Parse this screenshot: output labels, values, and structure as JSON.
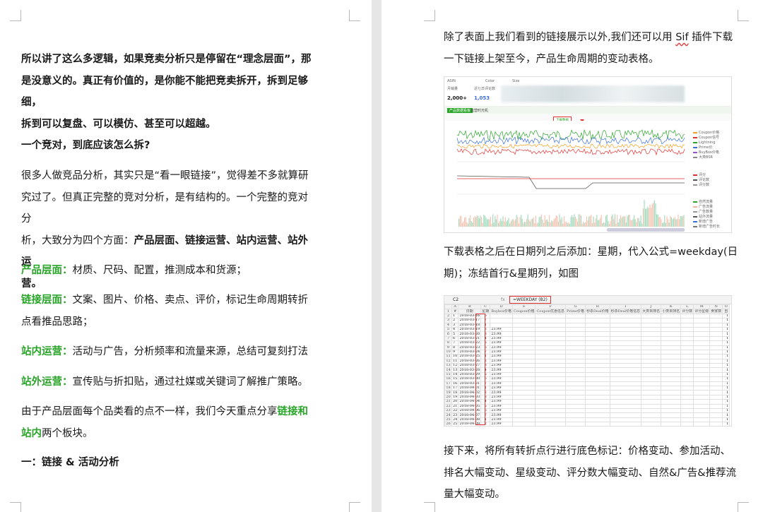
{
  "left_page": {
    "intro": [
      "所以讲了这么多逻辑，如果竞卖分析只是停留在“理念层面”，那",
      "是没意义的。真正有价值的，是你能不能把竞卖拆开，拆到足够细，",
      "拆到可以复盘、可以模仿、甚至可以超越。"
    ],
    "heading": "一个竞对，到底应该怎么拆?",
    "body1": [
      "很多人做竞品分析，其实只是“看一眼链接”，觉得差不多就算研",
      "究过了。但真正完整的竞对分析，是有结构的。一个完整的竞对分",
      "析，大致分为四个方面："
    ],
    "body1_bold_tail": "产品层面、链接运营、站内运营、站外运",
    "body1_last": "营。",
    "items": [
      {
        "label": "产品层面：",
        "text": "材质、尺码、配置，推测成本和货源；"
      },
      {
        "label": "链接层面：",
        "text": "文案、图片、价格、卖点、评价，标记生命周期转折",
        "text2": "点看推品思路；"
      },
      {
        "label": "站内运营：",
        "text": "活动与广告，分析频率和流量来源，总结可复刻打法"
      },
      {
        "label": "站外运营：",
        "text": "宣传贴与折扣贴，通过社媒或关键词了解推广策略。"
      }
    ],
    "closing_1": "由于产品层面每个品类看的点不一样，我们今天重点分享",
    "closing_green": "链接和",
    "closing_green2": "站内",
    "closing_2": "两个板块。",
    "section": "一：链接  &  活动分析"
  },
  "right_page": {
    "p1_a": "除了表面上我们看到的链接展示以外,我们还可以用 ",
    "p1_sif": "Sif",
    "p1_b": " 插件下载",
    "p1_line2": "一下链接上架至今，产品生命周期的变动表格。",
    "p2_line1": "下载表格之后在日期列之后添加：星期，代入公式=weekday(日",
    "p2_line2": "期)；冻结首行&星期列，如图",
    "p3_line1": "接下来，将所有转折点行进行底色标记：价格变动、参加活动、",
    "p3_line2": "排名大幅变动、星级变动、评分数大幅变动、自然&广告&推荐流",
    "p3_line3": "量大幅变动。"
  },
  "shot1": {
    "asin_label": "ASIN",
    "color_label": "Color",
    "size_label": "Size",
    "stat1_label": "月销量",
    "stat1_value": "2,000+",
    "stat2_label": "近七日评论数",
    "stat2_value": "1,053",
    "tab1": "产品数据看板",
    "tab2": "运营时光机",
    "download_btn": "下载数据",
    "legend": [
      "Coupon价格",
      "Coupon信号",
      "Lightning",
      "Prime价",
      "BuyBox价格",
      "大类BSR"
    ],
    "legend2": [
      "评分",
      "评论数",
      "评分数"
    ],
    "legend3": [
      "自然流量",
      "广告流量",
      "广告数量",
      "站外流量",
      "新增广告",
      "新增广告时长"
    ],
    "colors": {
      "green": "#2aa52a",
      "red": "#d33",
      "blue": "#3a6fd8",
      "orange": "#f0a020",
      "purple": "#9a4fd0"
    }
  },
  "shot2": {
    "cell_ref": "C2",
    "formula": "=WEEKDAY (B2)",
    "col_letters": [
      "A",
      "B",
      "C",
      "D",
      "E",
      "F",
      "G",
      "H",
      "I",
      "J",
      "K",
      "L",
      "M",
      "N",
      "O"
    ],
    "headers": [
      "#",
      "日期",
      "星期",
      "Buybox价格",
      "Coupon价格",
      "Coupon优惠信息",
      "Prime价格",
      "秒杀Deal价格",
      "秒杀Deal价格信息",
      "大类目排名",
      "小类目排名",
      "评分数",
      "评分星级",
      "卖家数",
      "自"
    ],
    "rows": [
      [
        "1",
        "2018-03-16",
        "6",
        "",
        ""
      ],
      [
        "2",
        "2018-03-17",
        "7",
        "",
        ""
      ],
      [
        "3",
        "2018-03-18",
        "1",
        "",
        ""
      ],
      [
        "4",
        "2018-03-19",
        "2",
        "23.99",
        ""
      ],
      [
        "5",
        "2018-03-20",
        "3",
        "23.99",
        ""
      ],
      [
        "6",
        "2018-03-21",
        "4",
        "23.99",
        ""
      ],
      [
        "7",
        "2018-03-22",
        "5",
        "23.99",
        ""
      ],
      [
        "8",
        "2018-03-23",
        "6",
        "23.99",
        ""
      ],
      [
        "9",
        "2018-03-24",
        "7",
        "23.99",
        ""
      ],
      [
        "10",
        "2018-03-25",
        "1",
        "23.99",
        ""
      ],
      [
        "11",
        "2018-03-26",
        "2",
        "23.99",
        ""
      ],
      [
        "12",
        "2018-03-27",
        "3",
        "23.99",
        ""
      ],
      [
        "13",
        "2018-03-28",
        "4",
        "23.99",
        ""
      ],
      [
        "14",
        "2018-03-29",
        "5",
        "23.99",
        ""
      ],
      [
        "15",
        "2018-03-30",
        "6",
        "23.99",
        ""
      ],
      [
        "16",
        "2018-03-31",
        "7",
        "23.99",
        ""
      ],
      [
        "17",
        "2018-04-01",
        "1",
        "23.99",
        ""
      ],
      [
        "18",
        "2018-04-02",
        "2",
        "23.99",
        ""
      ],
      [
        "19",
        "2018-04-03",
        "3",
        "23.99",
        ""
      ],
      [
        "20",
        "2018-04-04",
        "4",
        "23.99",
        ""
      ],
      [
        "21",
        "2018-04-05",
        "5",
        "23.99",
        ""
      ],
      [
        "22",
        "2018-04-06",
        "6",
        "23.99",
        ""
      ],
      [
        "23",
        "2018-04-07",
        "7",
        "23.99",
        ""
      ],
      [
        "24",
        "2018-04-08",
        "1",
        "23.99",
        ""
      ],
      [
        "25",
        "2018-04-09",
        "2",
        "23.99",
        ""
      ]
    ]
  }
}
